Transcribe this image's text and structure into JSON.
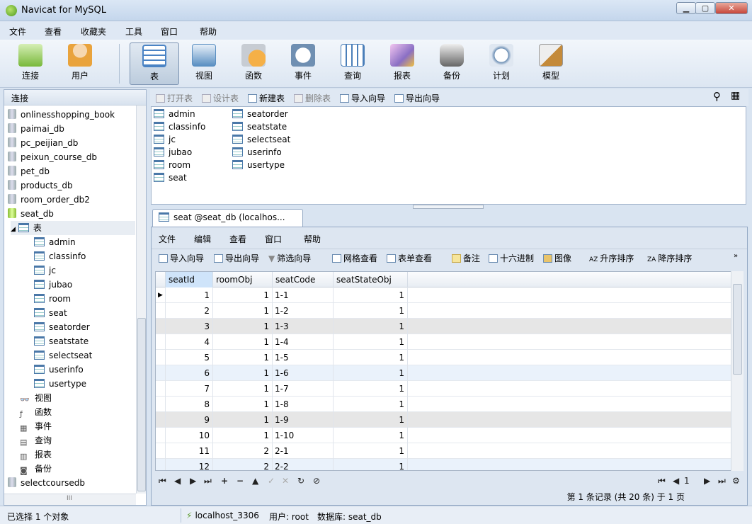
{
  "window": {
    "title": "Navicat for MySQL",
    "minimize": "▁",
    "maximize": "▢",
    "close": "✕"
  },
  "menu": [
    "文件",
    "查看",
    "收藏夹",
    "工具",
    "窗口",
    "帮助"
  ],
  "toolbar": [
    {
      "label": "连接",
      "icon": "connection-icon",
      "color": "#78b83a"
    },
    {
      "label": "用户",
      "icon": "user-icon",
      "color": "#e9a33c"
    },
    {
      "label": "表",
      "icon": "table-icon",
      "color": "#4a83c4",
      "active": true
    },
    {
      "label": "视图",
      "icon": "view-icon",
      "color": "#5a8fc2"
    },
    {
      "label": "函数",
      "icon": "function-icon",
      "color": "#d9872a"
    },
    {
      "label": "事件",
      "icon": "event-icon",
      "color": "#6f8fb2"
    },
    {
      "label": "查询",
      "icon": "query-icon",
      "color": "#4b7fb9"
    },
    {
      "label": "报表",
      "icon": "report-icon",
      "color": "#8a6fc4"
    },
    {
      "label": "备份",
      "icon": "backup-icon",
      "color": "#666666"
    },
    {
      "label": "计划",
      "icon": "schedule-icon",
      "color": "#6a8db3"
    },
    {
      "label": "模型",
      "icon": "model-icon",
      "color": "#c48a3a"
    }
  ],
  "sidebar": {
    "header": "连接",
    "databases_above": [
      "onlinesshopping_book",
      "paimai_db",
      "pc_peijian_db",
      "peixun_course_db",
      "pet_db",
      "products_db",
      "room_order_db2"
    ],
    "open_db": "seat_db",
    "tables_node": "表",
    "tables": [
      "admin",
      "classinfo",
      "jc",
      "jubao",
      "room",
      "seat",
      "seatorder",
      "seatstate",
      "selectseat",
      "userinfo",
      "usertype"
    ],
    "other_nodes": [
      {
        "label": "视图",
        "icon": "view-icon",
        "glyph": "👓"
      },
      {
        "label": "函数",
        "icon": "function-icon",
        "glyph": "ƒ"
      },
      {
        "label": "事件",
        "icon": "event-icon",
        "glyph": "▦"
      },
      {
        "label": "查询",
        "icon": "query-icon",
        "glyph": "▤"
      },
      {
        "label": "报表",
        "icon": "report-icon",
        "glyph": "▥"
      },
      {
        "label": "备份",
        "icon": "backup-icon",
        "glyph": "◙"
      }
    ],
    "databases_below": [
      "selectcoursedb"
    ],
    "hscroll_label": "III"
  },
  "object_toolbar": [
    {
      "label": "打开表",
      "disabled": true
    },
    {
      "label": "设计表",
      "disabled": true
    },
    {
      "label": "新建表",
      "disabled": false
    },
    {
      "label": "删除表",
      "disabled": true
    },
    {
      "label": "导入向导",
      "disabled": false
    },
    {
      "label": "导出向导",
      "disabled": false
    }
  ],
  "object_list": {
    "col1": [
      "admin",
      "classinfo",
      "jc",
      "jubao",
      "room",
      "seat"
    ],
    "col2": [
      "seatorder",
      "seatstate",
      "selectseat",
      "userinfo",
      "usertype"
    ]
  },
  "tab": {
    "label": "seat @seat_db (localhos..."
  },
  "tab_menu": [
    "文件",
    "编辑",
    "查看",
    "窗口",
    "帮助"
  ],
  "tab_toolbar": [
    "导入向导",
    "导出向导",
    "筛选向导",
    "网格查看",
    "表单查看",
    "备注",
    "十六进制",
    "图像",
    "升序排序",
    "降序排序"
  ],
  "grid": {
    "columns": [
      "seatId",
      "roomObj",
      "seatCode",
      "seatStateObj"
    ],
    "rows": [
      [
        "1",
        "1",
        "1-1",
        "1"
      ],
      [
        "2",
        "1",
        "1-2",
        "1"
      ],
      [
        "3",
        "1",
        "1-3",
        "1"
      ],
      [
        "4",
        "1",
        "1-4",
        "1"
      ],
      [
        "5",
        "1",
        "1-5",
        "1"
      ],
      [
        "6",
        "1",
        "1-6",
        "1"
      ],
      [
        "7",
        "1",
        "1-7",
        "1"
      ],
      [
        "8",
        "1",
        "1-8",
        "1"
      ],
      [
        "9",
        "1",
        "1-9",
        "1"
      ],
      [
        "10",
        "1",
        "1-10",
        "1"
      ],
      [
        "11",
        "2",
        "2-1",
        "1"
      ],
      [
        "12",
        "2",
        "2-2",
        "1"
      ]
    ]
  },
  "nav": {
    "buttons": [
      "⏮",
      "◀",
      "▶",
      "⏭",
      "+",
      "−",
      "▲",
      "✓",
      "✕",
      "↻",
      "⊘"
    ],
    "page": "1",
    "page_info": "第 1 条记录 (共 20 条) 于 1 页"
  },
  "status": {
    "selected": "已选择 1 个对象",
    "connection": "localhost_3306",
    "user": "用户: root",
    "database": "数据库: seat_db"
  }
}
